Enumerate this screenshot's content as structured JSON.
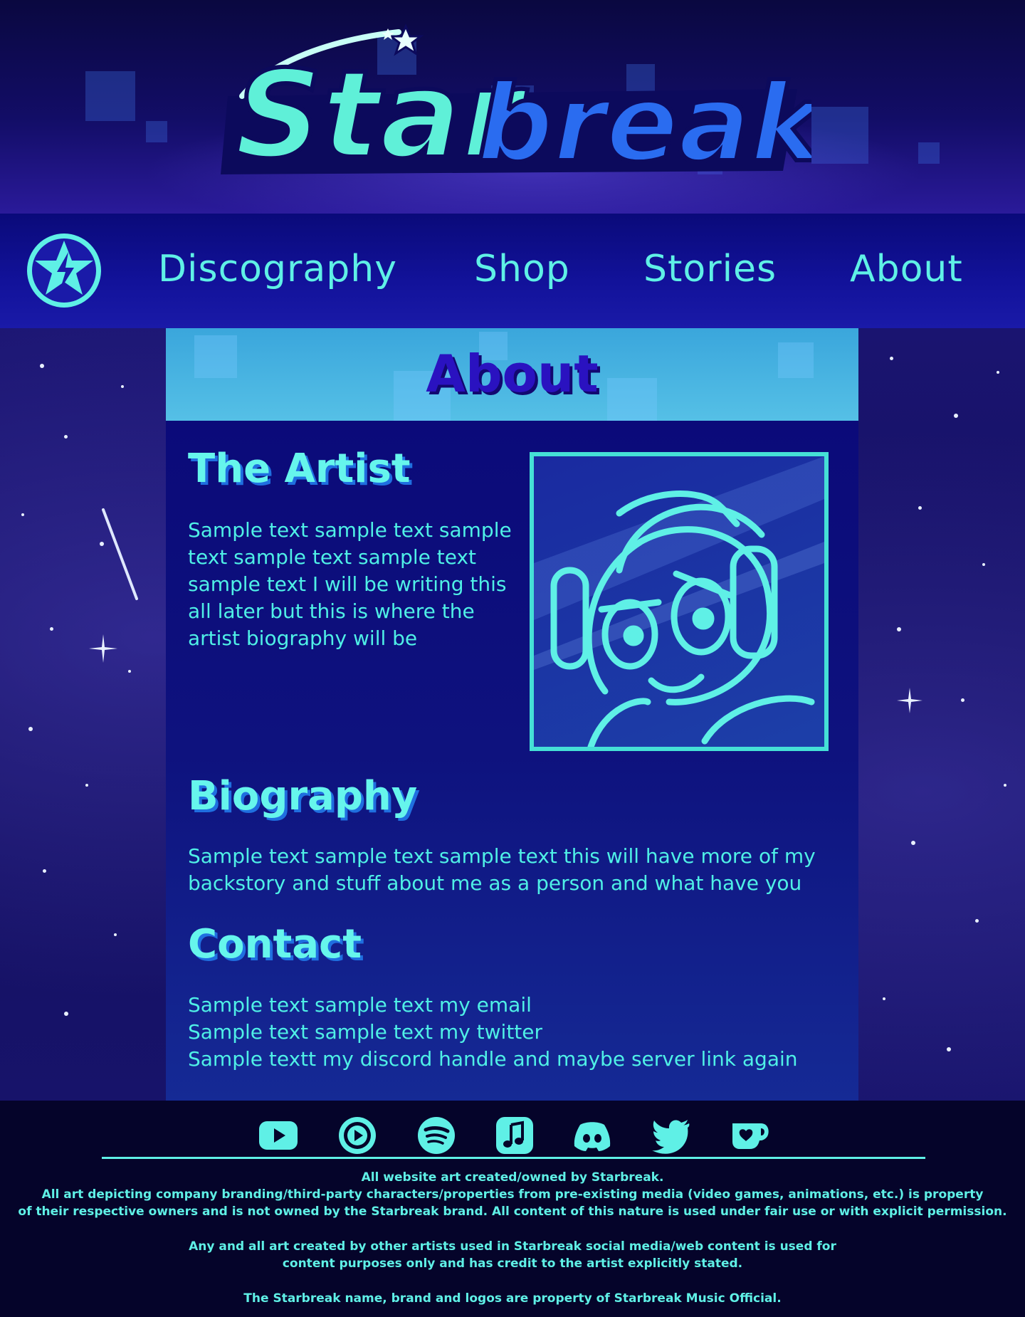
{
  "brand": {
    "logo_text_part1": "Star",
    "logo_text_part2": "break"
  },
  "nav": {
    "items": [
      {
        "label": "Discography"
      },
      {
        "label": "Shop"
      },
      {
        "label": "Stories"
      },
      {
        "label": "About"
      }
    ]
  },
  "page": {
    "title": "About"
  },
  "sections": {
    "artist": {
      "heading": "The Artist",
      "lines": [
        "Sample text sample text sample",
        "text sample text sample text",
        "sample text I will be writing this",
        "all later but this is where the",
        "artist biography will be"
      ]
    },
    "biography": {
      "heading": "Biography",
      "lines": [
        "Sample text sample text sample text this will have more of my",
        "backstory and stuff about me as a person and what have you"
      ]
    },
    "contact": {
      "heading": "Contact",
      "lines": [
        "Sample text sample text my email",
        "Sample text sample text my twitter",
        "Sample textt my discord handle and maybe server link again"
      ]
    }
  },
  "footer": {
    "social_icons": [
      "youtube-icon",
      "play-circle-icon",
      "spotify-icon",
      "apple-music-icon",
      "discord-icon",
      "twitter-icon",
      "kofi-icon"
    ],
    "fine_print": [
      "All website art created/owned by Starbreak.",
      "All art depicting company branding/third-party characters/properties from pre-existing media (video games, animations, etc.) is property",
      "of their respective owners and is not owned by the Starbreak brand. All content of this nature is used under fair use or with explicit permission.",
      "Any and all art created by other artists used in Starbreak social media/web content is used for",
      "content purposes only and has credit to the artist explicitly stated.",
      "The Starbreak name, brand and logos are property of Starbreak Music Official."
    ]
  },
  "colors": {
    "accent": "#5ff0e6",
    "nav_bg": "#0a0a7a",
    "panel_bg": "#0a0878",
    "panel_header": "#55c0e6",
    "title_text": "#2a12c0",
    "footer_bg": "#05042a"
  }
}
